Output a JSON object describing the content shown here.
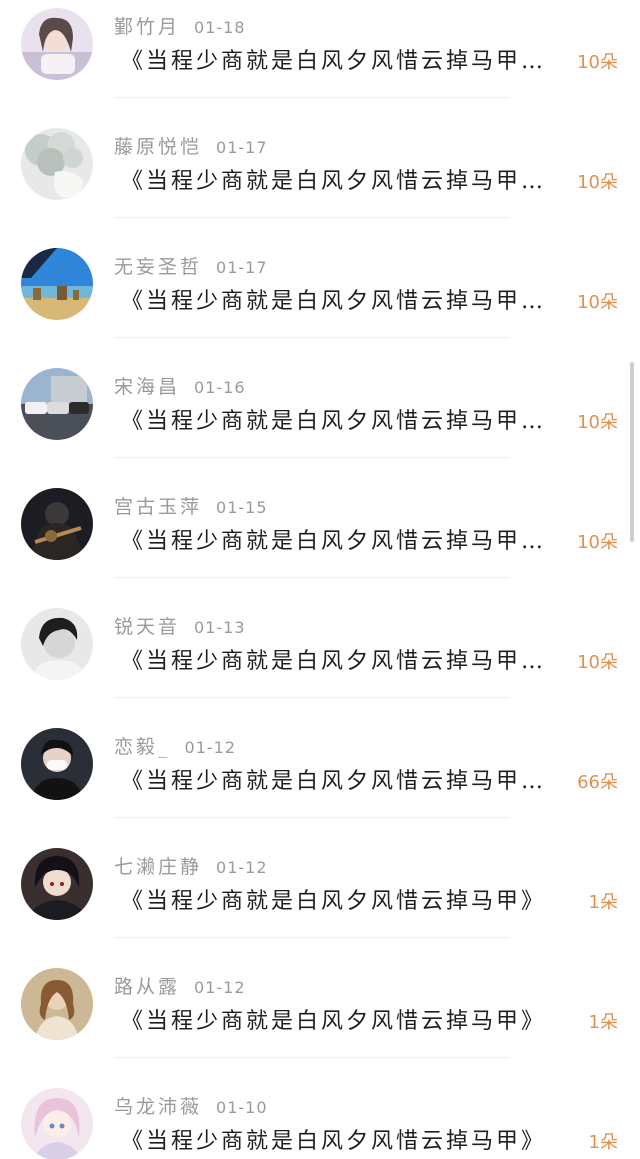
{
  "items": [
    {
      "name": "鄞竹月",
      "date": "01-18",
      "title": "《当程少商就是白风夕风惜云掉马甲…",
      "count": "10朵",
      "avatar": "avatar-girl-doll-icon"
    },
    {
      "name": "藤原悦恺",
      "date": "01-17",
      "title": "《当程少商就是白风夕风惜云掉马甲…",
      "count": "10朵",
      "avatar": "avatar-flowers-vase-icon"
    },
    {
      "name": "无妄圣哲",
      "date": "01-17",
      "title": "《当程少商就是白风夕风惜云掉马甲…",
      "count": "10朵",
      "avatar": "avatar-seaside-rocks-icon"
    },
    {
      "name": "宋海昌",
      "date": "01-16",
      "title": "《当程少商就是白风夕风惜云掉马甲…",
      "count": "10朵",
      "avatar": "avatar-cars-showroom-icon"
    },
    {
      "name": "宫古玉萍",
      "date": "01-15",
      "title": "《当程少商就是白风夕风惜云掉马甲…",
      "count": "10朵",
      "avatar": "avatar-dark-warrior-icon"
    },
    {
      "name": "锐天音",
      "date": "01-13",
      "title": "《当程少商就是白风夕风惜云掉马甲…",
      "count": "10朵",
      "avatar": "avatar-bw-portrait-icon"
    },
    {
      "name": "恋毅_",
      "date": "01-12",
      "title": "《当程少商就是白风夕风惜云掉马甲…",
      "count": "66朵",
      "avatar": "avatar-masked-boy-icon"
    },
    {
      "name": "七濑庄静",
      "date": "01-12",
      "title": "《当程少商就是白风夕风惜云掉马甲》",
      "count": "1朵",
      "avatar": "avatar-anime-dark-hair-icon"
    },
    {
      "name": "路从露",
      "date": "01-12",
      "title": "《当程少商就是白风夕风惜云掉马甲》",
      "count": "1朵",
      "avatar": "avatar-vintage-lady-icon"
    },
    {
      "name": "乌龙沛薇",
      "date": "01-10",
      "title": "《当程少商就是白风夕风惜云掉马甲》",
      "count": "1朵",
      "avatar": "avatar-anime-pink-hair-icon"
    }
  ],
  "colors": {
    "count_accent": "#e0904f",
    "meta_gray": "#9a9a9a",
    "title_text": "#1f1f1f"
  }
}
